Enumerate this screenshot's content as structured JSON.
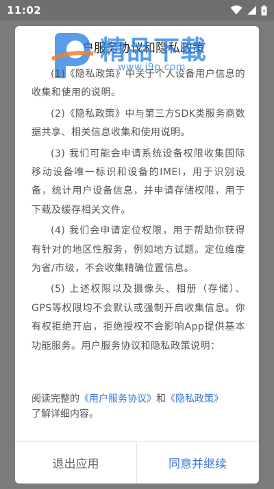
{
  "status_bar": {
    "time": "11:02",
    "icons": [
      "wifi-icon",
      "signal-icon",
      "battery-icon"
    ]
  },
  "dialog": {
    "title": "用户服务协议和隐私政策",
    "watermark": {
      "brand": "精品下载",
      "url": "www.j9p.com"
    },
    "paragraphs": [
      "(1)《隐私政策》中关于个人设备用户信息的收集和使用的说明。",
      "(2)《隐私政策》中与第三方SDK类服务商数据共享、相关信息收集和使用说明。",
      "(3) 我们可能会申请系统设备权限收集国际移动设备唯一标识和设备的IMEI，用于识别设备，统计用户设备信息，并申请存储权限，用于下载及缓存相关文件。",
      "(4) 我们会申请定位权限，用于帮助你获得有针对的地区性服务，例如地方试题。定位维度为省/市级，不会收集精确位置信息。",
      "(5) 上述权限以及摄像头、相册（存储）、GPS等权限均不会默认或强制开启收集信息。你有权拒绝开启，拒绝授权不会影响App提供基本功能服务。用户服务协议和隐私政策说明："
    ],
    "footer": {
      "prefix": "阅读完整的",
      "link_agreement": "《用户服务协议》",
      "middle": "和",
      "link_privacy": "《隐私政策》",
      "suffix": "了解详细内容。"
    },
    "buttons": {
      "exit": "退出应用",
      "agree": "同意并继续"
    }
  },
  "colors": {
    "accent": "#3a78d8",
    "overlay": "#7b7b7b",
    "text": "#555555"
  }
}
